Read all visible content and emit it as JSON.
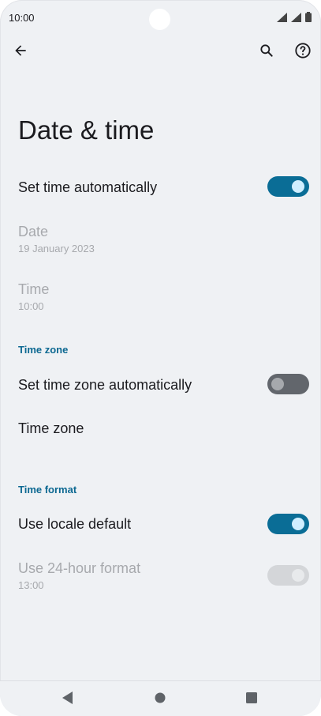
{
  "status_bar": {
    "time": "10:00",
    "icons": [
      "signal-icon",
      "signal-icon",
      "battery-icon"
    ]
  },
  "top_bar": {
    "icons": [
      "back-arrow-icon",
      "search-icon",
      "help-icon"
    ]
  },
  "page": {
    "title": "Date & time"
  },
  "settings": {
    "set_time_automatically": {
      "label": "Set time automatically",
      "enabled": true
    },
    "date": {
      "label": "Date",
      "value": "19 January 2023",
      "disabled": true
    },
    "time": {
      "label": "Time",
      "value": "10:00",
      "disabled": true
    },
    "time_zone_section": "Time zone",
    "set_time_zone_automatically": {
      "label": "Set time zone automatically",
      "enabled": false
    },
    "time_zone": {
      "label": "Time zone"
    },
    "time_format_section": "Time format",
    "use_locale_default": {
      "label": "Use locale default",
      "enabled": true
    },
    "use_24_hour_format": {
      "label": "Use 24-hour format",
      "value": "13:00",
      "enabled": true,
      "disabled": true
    }
  },
  "colors": {
    "accent": "#0c6891",
    "toggle_on": "#0a6d96",
    "toggle_off": "#62666c",
    "background": "#eff1f4",
    "disabled_text": "#a7a9ad"
  },
  "nav_bar": {
    "icons": [
      "back-triangle-icon",
      "home-circle-icon",
      "recents-square-icon"
    ]
  }
}
